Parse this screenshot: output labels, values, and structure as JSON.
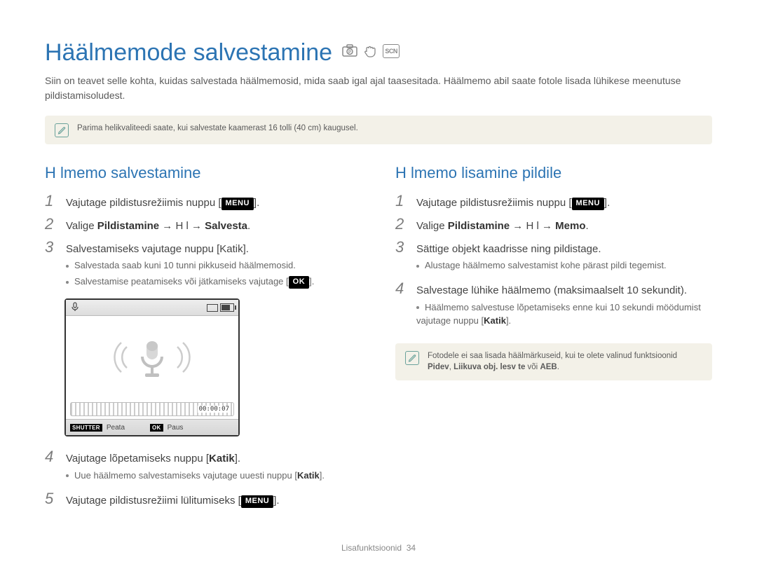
{
  "page": {
    "title": "Häälmemode salvestamine",
    "intro": "Siin on teavet selle kohta, kuidas salvestada häälmemosid, mida saab igal ajal taasesitada. Häälmemo abil saate fotole lisada lühikese meenutuse pildistamisoludest.",
    "footer_section": "Lisafunktsioonid",
    "footer_page": "34"
  },
  "tip_top": "Parima helikvaliteedi saate, kui salvestate kaamerast 16 tolli (40 cm) kaugusel.",
  "left": {
    "heading": "H   lmemo salvestamine",
    "steps": {
      "s1_pre": "Vajutage pildistusrežiimis nuppu [",
      "s1_btn": "MENU",
      "s1_post": "].",
      "s2_pre": "Valige ",
      "s2_bold1": "Pildistamine",
      "s2_mid": " → H   l → ",
      "s2_bold2": "Salvesta",
      "s2_post": ".",
      "s3": "Salvestamiseks vajutage nuppu [Katik].",
      "s3_sub1": "Salvestada saab kuni 10 tunni pikkuseid häälmemosid.",
      "s3_sub2_pre": "Salvestamise peatamiseks või jätkamiseks vajutage [",
      "s3_sub2_btn": "OK",
      "s3_sub2_post": "].",
      "s4_pre": "Vajutage lõpetamiseks nuppu [",
      "s4_bold": "Katik",
      "s4_post": "].",
      "s4_sub_pre": "Uue häälmemo salvestamiseks vajutage uuesti nuppu [",
      "s4_sub_bold": "Katik",
      "s4_sub_post": "].",
      "s5_pre": "Vajutage pildistusrežiimi lülitumiseks [",
      "s5_btn": "MENU",
      "s5_post": "]."
    },
    "lcd": {
      "timecode": "00:00:07",
      "foot_shutter_btn": "SHUTTER",
      "foot_shutter_text": "Peata",
      "foot_ok_btn": "OK",
      "foot_ok_text": "Paus"
    }
  },
  "right": {
    "heading": "H   lmemo lisamine pildile",
    "steps": {
      "s1_pre": "Vajutage pildistusrežiimis nuppu [",
      "s1_btn": "MENU",
      "s1_post": "].",
      "s2_pre": "Valige ",
      "s2_bold1": "Pildistamine",
      "s2_mid": " → H   l → ",
      "s2_bold2": "Memo",
      "s2_post": ".",
      "s3": "Sättige objekt kaadrisse ning pildistage.",
      "s3_sub1": "Alustage häälmemo salvestamist kohe pärast pildi tegemist.",
      "s4": "Salvestage lühike häälmemo (maksimaalselt 10 sekundit).",
      "s4_sub_pre": "Häälmemo salvestuse lõpetamiseks enne kui 10 sekundi möödumist vajutage nuppu [",
      "s4_sub_bold": "Katik",
      "s4_sub_post": "]."
    },
    "tip_line1": "Fotodele ei saa lisada häälmärkuseid, kui te olete valinud funktsioonid",
    "tip_line2_pre": "",
    "tip_line2_b1": "Pidev",
    "tip_line2_sep1": ", ",
    "tip_line2_b2": "Liikuva obj.   lesv te",
    "tip_line2_mid": "   või ",
    "tip_line2_b3": "AEB",
    "tip_line2_post": "."
  }
}
